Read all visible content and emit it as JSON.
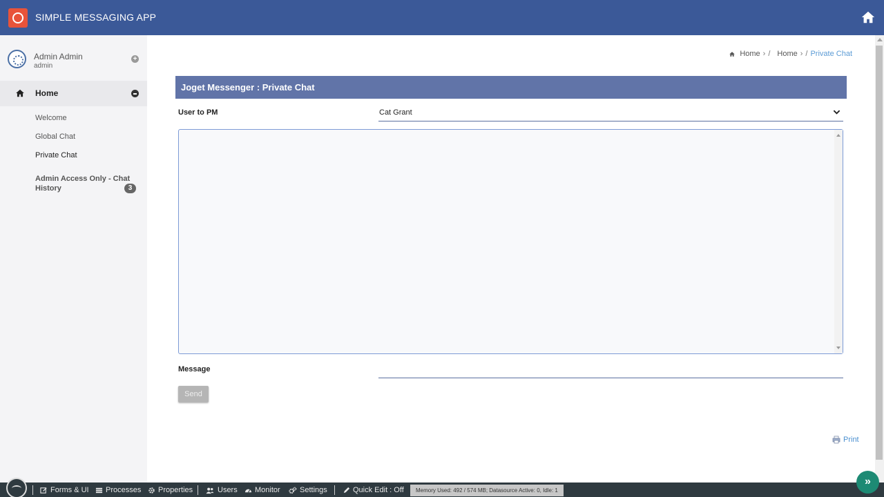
{
  "header": {
    "app_title": "SIMPLE MESSAGING APP",
    "logo_icon": "chat-bubble-icon",
    "home_icon": "home-icon",
    "bg_color": "#3b5998"
  },
  "sidebar": {
    "profile": {
      "name": "Admin Admin",
      "username": "admin"
    },
    "home_label": "Home",
    "items": [
      {
        "label": "Welcome"
      },
      {
        "label": "Global Chat"
      },
      {
        "label": "Private Chat"
      },
      {
        "label": "Admin Access Only - Chat History",
        "badge": "3"
      }
    ]
  },
  "breadcrumb": {
    "items": [
      "Home",
      "Home"
    ],
    "current": "Private Chat",
    "sep1": "›",
    "slash1": "/",
    "sep2": "›",
    "slash2": "/"
  },
  "form": {
    "title": "Joget Messenger : Private Chat",
    "user_label": "User to PM",
    "user_value": "Cat Grant",
    "message_label": "Message",
    "message_value": "",
    "send_label": "Send",
    "print_label": "Print"
  },
  "bottombar": {
    "items": [
      {
        "label": "Forms & UI",
        "icon": "edit-icon"
      },
      {
        "label": "Processes",
        "icon": "list-icon"
      },
      {
        "label": "Properties",
        "icon": "gear-icon"
      },
      {
        "label": "Users",
        "icon": "users-icon"
      },
      {
        "label": "Monitor",
        "icon": "dashboard-icon"
      },
      {
        "label": "Settings",
        "icon": "gears-icon"
      },
      {
        "label": "Quick Edit : Off",
        "icon": "pencil-icon"
      }
    ],
    "memory": "Memory Used: 492 / 574 MB; Datasource Active: 0, Idle: 1",
    "fab": "»"
  }
}
